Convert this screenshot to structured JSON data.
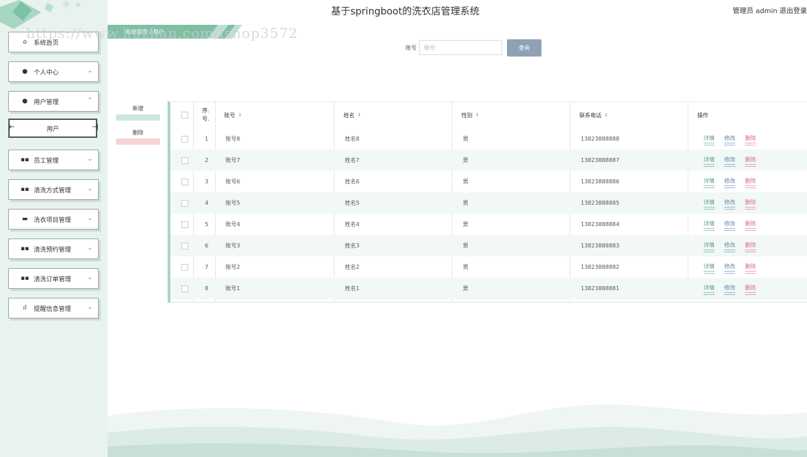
{
  "header": {
    "title": "基于springboot的洗衣店管理系统",
    "user_info": "管理员 admin  退出登录"
  },
  "watermark": "https://www.huzhan.com/ishop3572",
  "breadcrumb": "系统首页  /  用户",
  "sidebar": {
    "items": [
      {
        "label": "系统首页",
        "icon": "home-icon",
        "glyph": "⌂"
      },
      {
        "label": "个人中心",
        "icon": "person-icon",
        "glyph": "●"
      },
      {
        "label": "用户管理",
        "icon": "person-icon",
        "glyph": "●"
      },
      {
        "label": "员工管理",
        "icon": "grid-icon",
        "glyph": "▪▪"
      },
      {
        "label": "清洗方式管理",
        "icon": "grid-icon",
        "glyph": "▪▪"
      },
      {
        "label": "洗衣项目管理",
        "icon": "briefcase-icon",
        "glyph": "▬"
      },
      {
        "label": "清洗预约管理",
        "icon": "grid-icon",
        "glyph": "▪▪"
      },
      {
        "label": "清洗订单管理",
        "icon": "grid-icon",
        "glyph": "▪▪"
      },
      {
        "label": "提醒信息管理",
        "icon": "bar-chart-icon",
        "glyph": "ıl"
      }
    ],
    "submenu_label": "用户"
  },
  "search": {
    "label": "账号",
    "placeholder": "账号",
    "button": "查询"
  },
  "actions": {
    "add": "新增",
    "delete": "删除"
  },
  "table": {
    "headers": {
      "index": "序.号.",
      "account": "账号",
      "name": "姓名",
      "gender": "性别",
      "phone": "联系电话",
      "ops": "操作"
    },
    "row_ops": {
      "detail": "详情",
      "edit": "修改",
      "delete": "删除"
    },
    "rows": [
      {
        "index": "1",
        "account": "账号8",
        "name": "姓名8",
        "gender": "男",
        "phone": "13823888888"
      },
      {
        "index": "2",
        "account": "账号7",
        "name": "姓名7",
        "gender": "男",
        "phone": "13823888887"
      },
      {
        "index": "3",
        "account": "账号6",
        "name": "姓名6",
        "gender": "男",
        "phone": "13823888886"
      },
      {
        "index": "4",
        "account": "账号5",
        "name": "姓名5",
        "gender": "男",
        "phone": "13823888885"
      },
      {
        "index": "5",
        "account": "账号4",
        "name": "姓名4",
        "gender": "男",
        "phone": "13823888884"
      },
      {
        "index": "6",
        "account": "账号3",
        "name": "姓名3",
        "gender": "男",
        "phone": "13823888883"
      },
      {
        "index": "7",
        "account": "账号2",
        "name": "姓名2",
        "gender": "男",
        "phone": "13823888882"
      },
      {
        "index": "8",
        "account": "账号1",
        "name": "姓名1",
        "gender": "男",
        "phone": "13823888881"
      }
    ]
  },
  "colors": {
    "accent_green": "#a9d6bf",
    "search_button": "#8ea1b6",
    "detail": "#5a9f85",
    "edit": "#5d86b0",
    "delete": "#d36f83"
  }
}
